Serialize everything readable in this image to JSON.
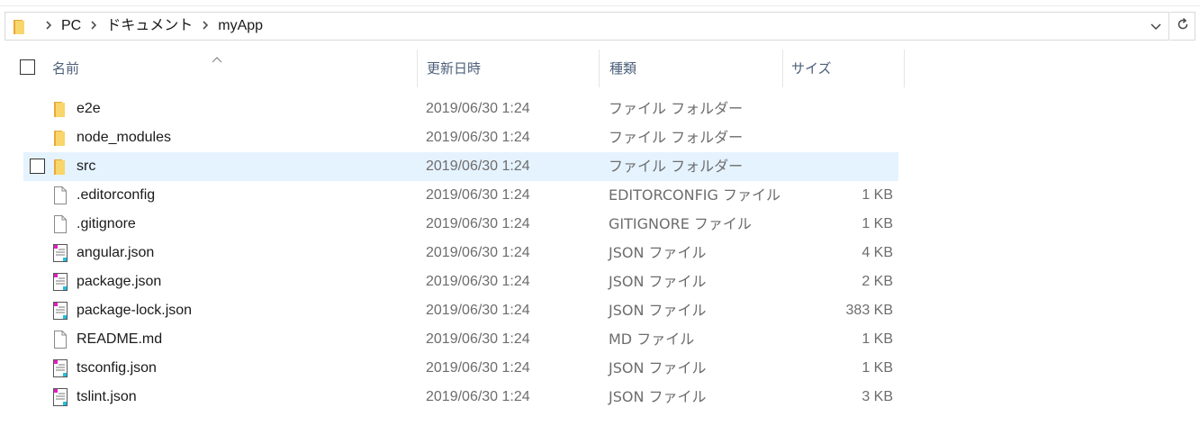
{
  "breadcrumb": {
    "items": [
      "PC",
      "ドキュメント",
      "myApp"
    ],
    "separator": ">"
  },
  "columns": {
    "name": "名前",
    "modified": "更新日時",
    "type": "種類",
    "size": "サイズ"
  },
  "colors": {
    "accent_hover": "#e5f3ff",
    "folder_yellow": "#f5c84c",
    "json_magenta": "#e020c0",
    "json_cyan": "#20c0e0"
  },
  "files": [
    {
      "name": "e2e",
      "modified": "2019/06/30 1:24",
      "type": "ファイル フォルダー",
      "size": "",
      "icon": "folder-icon"
    },
    {
      "name": "node_modules",
      "modified": "2019/06/30 1:24",
      "type": "ファイル フォルダー",
      "size": "",
      "icon": "folder-icon"
    },
    {
      "name": "src",
      "modified": "2019/06/30 1:24",
      "type": "ファイル フォルダー",
      "size": "",
      "icon": "folder-icon",
      "hovered": true
    },
    {
      "name": ".editorconfig",
      "modified": "2019/06/30 1:24",
      "type": "EDITORCONFIG ファイル",
      "size": "1 KB",
      "icon": "blank-file-icon"
    },
    {
      "name": ".gitignore",
      "modified": "2019/06/30 1:24",
      "type": "GITIGNORE ファイル",
      "size": "1 KB",
      "icon": "blank-file-icon"
    },
    {
      "name": "angular.json",
      "modified": "2019/06/30 1:24",
      "type": "JSON ファイル",
      "size": "4 KB",
      "icon": "json-file-icon"
    },
    {
      "name": "package.json",
      "modified": "2019/06/30 1:24",
      "type": "JSON ファイル",
      "size": "2 KB",
      "icon": "json-file-icon"
    },
    {
      "name": "package-lock.json",
      "modified": "2019/06/30 1:24",
      "type": "JSON ファイル",
      "size": "383 KB",
      "icon": "json-file-icon"
    },
    {
      "name": "README.md",
      "modified": "2019/06/30 1:24",
      "type": "MD ファイル",
      "size": "1 KB",
      "icon": "blank-file-icon"
    },
    {
      "name": "tsconfig.json",
      "modified": "2019/06/30 1:24",
      "type": "JSON ファイル",
      "size": "1 KB",
      "icon": "json-file-icon"
    },
    {
      "name": "tslint.json",
      "modified": "2019/06/30 1:24",
      "type": "JSON ファイル",
      "size": "3 KB",
      "icon": "json-file-icon"
    }
  ]
}
